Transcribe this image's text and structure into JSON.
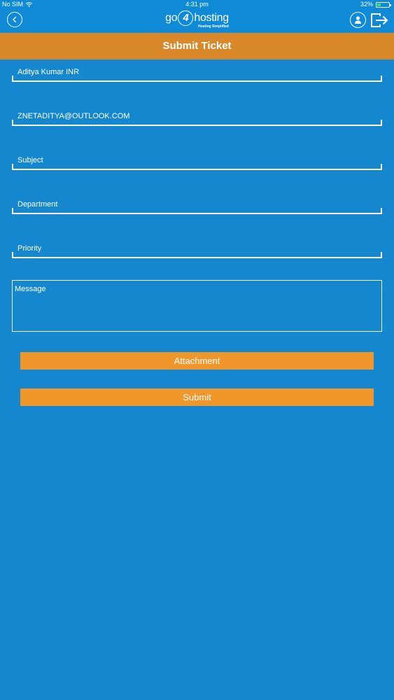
{
  "status_bar": {
    "carrier": "No SIM",
    "time": "4:31 pm",
    "battery_percent": "32%",
    "battery_level": 0.32
  },
  "header": {
    "logo_prefix": "go",
    "logo_number": "4",
    "logo_suffix": "hosting",
    "logo_tagline": "Hosting Simplified"
  },
  "page": {
    "title": "Submit Ticket"
  },
  "form": {
    "name_value": "Aditya Kumar INR",
    "email_value": "ZNETADITYA@OUTLOOK.COM",
    "subject_placeholder": "Subject",
    "department_placeholder": "Department",
    "priority_placeholder": "Priority",
    "message_placeholder": "Message"
  },
  "buttons": {
    "attachment_label": "Attachment",
    "submit_label": "Submit"
  },
  "colors": {
    "background": "#1587cf",
    "header": "#0f8ad6",
    "title_bar": "#d9892a",
    "button": "#f0972b",
    "battery": "#4cd964"
  }
}
